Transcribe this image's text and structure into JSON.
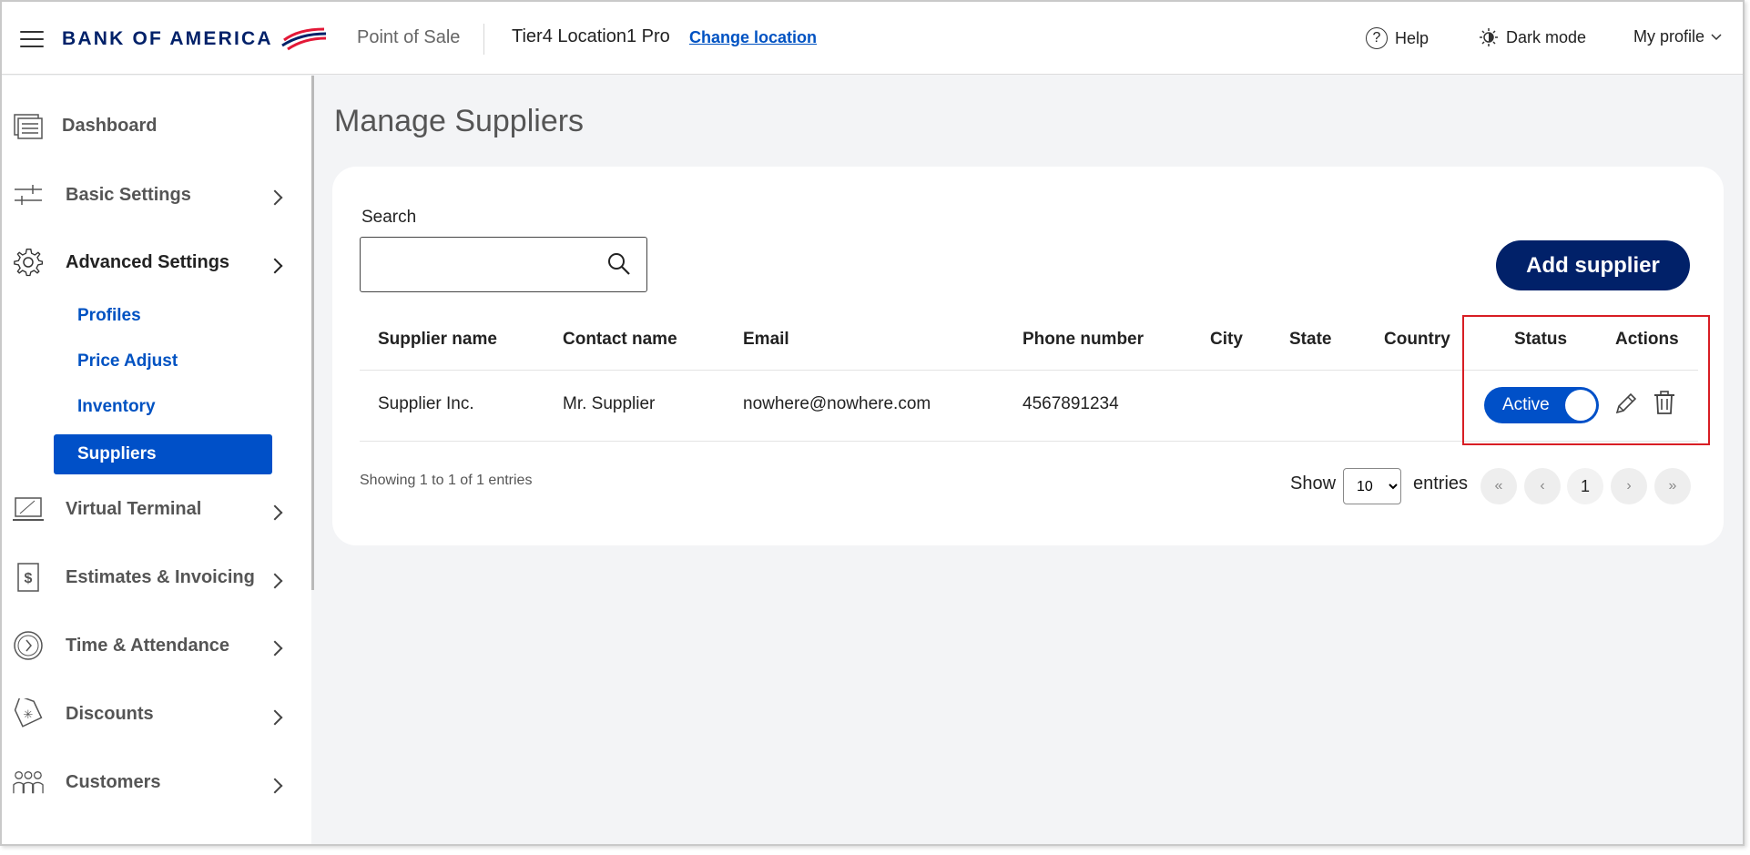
{
  "header": {
    "brand": "BANK OF AMERICA",
    "app_name": "Point of Sale",
    "location": "Tier4 Location1 Pro",
    "change_location": "Change location",
    "help": "Help",
    "dark_mode": "Dark mode",
    "profile": "My profile"
  },
  "sidebar": {
    "items": [
      {
        "label": "Dashboard",
        "icon": "dashboard-icon"
      },
      {
        "label": "Basic Settings",
        "icon": "sliders-icon"
      },
      {
        "label": "Advanced Settings",
        "icon": "gear-icon"
      },
      {
        "label": "Virtual Terminal",
        "icon": "laptop-icon"
      },
      {
        "label": "Estimates & Invoicing",
        "icon": "invoice-dollar-icon"
      },
      {
        "label": "Time & Attendance",
        "icon": "clock-icon"
      },
      {
        "label": "Discounts",
        "icon": "tag-icon"
      },
      {
        "label": "Customers",
        "icon": "people-icon"
      }
    ],
    "sub_items": [
      "Profiles",
      "Price Adjust",
      "Inventory",
      "Suppliers"
    ]
  },
  "main": {
    "title": "Manage Suppliers",
    "search_label": "Search",
    "search_value": "",
    "add_button": "Add supplier",
    "columns": [
      "Supplier name",
      "Contact name",
      "Email",
      "Phone number",
      "City",
      "State",
      "Country",
      "Status",
      "Actions"
    ],
    "rows": [
      {
        "supplier_name": "Supplier Inc.",
        "contact_name": "Mr. Supplier",
        "email": "nowhere@nowhere.com",
        "phone": "4567891234",
        "city": "",
        "state": "",
        "country": "",
        "status": "Active"
      }
    ],
    "showing": "Showing 1 to 1 of 1 entries",
    "show_label": "Show",
    "page_size": "10",
    "entries_label": "entries",
    "pager": {
      "first": "«",
      "prev": "‹",
      "current": "1",
      "next": "›",
      "last": "»"
    }
  },
  "colors": {
    "brand_navy": "#012169",
    "link_blue": "#0052c2",
    "active_blue": "#0050c8",
    "highlight_red": "#d81e24"
  }
}
